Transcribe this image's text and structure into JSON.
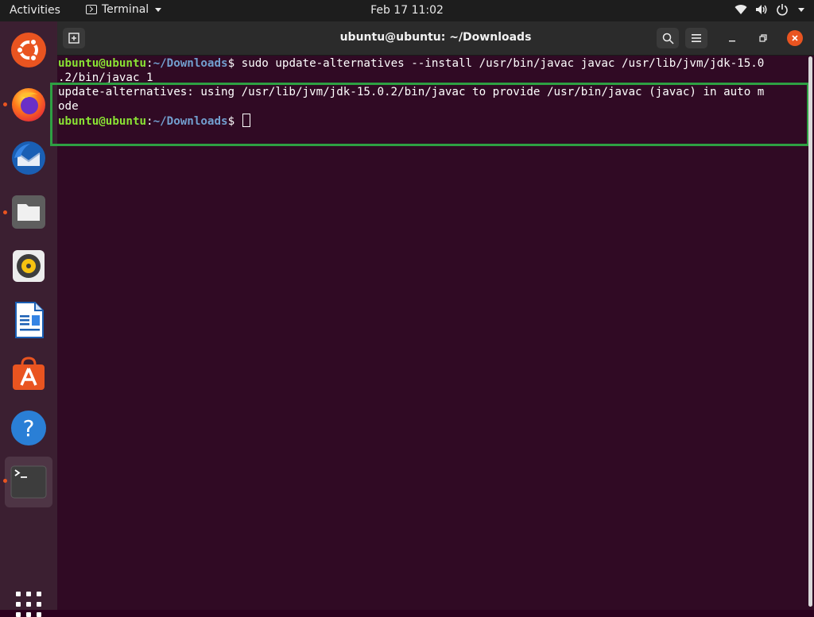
{
  "topbar": {
    "activities": "Activities",
    "app_name": "Terminal",
    "clock": "Feb 17  11:02",
    "tray_icons": [
      "wifi-icon",
      "volume-icon",
      "power-icon",
      "chevron-down-icon"
    ]
  },
  "dock": {
    "apps": [
      "ubuntu-logo",
      "firefox",
      "thunderbird",
      "files",
      "rhythmbox",
      "libreoffice-writer",
      "ubuntu-software",
      "help",
      "terminal"
    ],
    "running_indicator_color": "#e95420"
  },
  "window": {
    "title": "ubuntu@ubuntu: ~/Downloads"
  },
  "terminal": {
    "line1": {
      "user": "ubuntu@ubuntu",
      "colon": ":",
      "path": "~/Downloads",
      "dollar": "$",
      "command": " sudo update-alternatives --install /usr/bin/javac javac /usr/lib/jvm/jdk-15.0"
    },
    "line2": ".2/bin/javac 1",
    "line3": "update-alternatives: using /usr/lib/jvm/jdk-15.0.2/bin/javac to provide /usr/bin/javac (javac) in auto m",
    "line4": "ode",
    "line5": {
      "user": "ubuntu@ubuntu",
      "colon": ":",
      "path": "~/Downloads",
      "dollar": "$",
      "command": " "
    }
  },
  "colors": {
    "terminal_bg": "#300a24",
    "prompt_user": "#8ae234",
    "prompt_path": "#729fcf",
    "highlight": "#2ea043",
    "accent": "#e95420"
  }
}
